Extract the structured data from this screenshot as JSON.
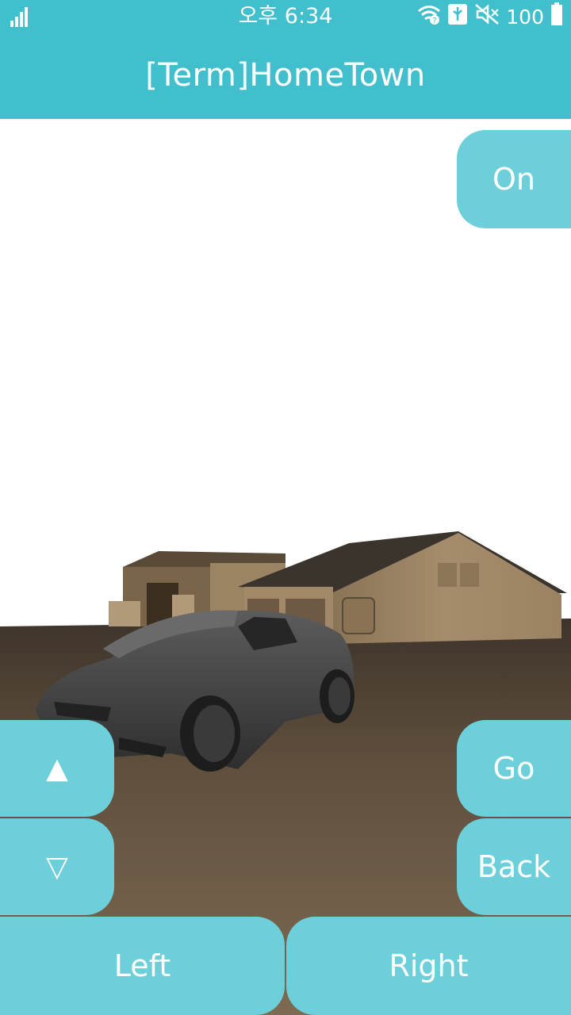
{
  "status": {
    "time": "오후 6:34",
    "battery": "100",
    "icons": [
      "signal-icon",
      "wifi-icon",
      "usb-icon",
      "mute-icon",
      "battery-icon"
    ]
  },
  "app": {
    "title": "[Term]HomeTown"
  },
  "controls": {
    "on": "On",
    "up": "▲",
    "down": "▽",
    "go": "Go",
    "back": "Back",
    "left": "Left",
    "right": "Right"
  },
  "colors": {
    "accent": "#42bfcd",
    "button": "#6dcfd9",
    "ground": "#6b5a45"
  }
}
